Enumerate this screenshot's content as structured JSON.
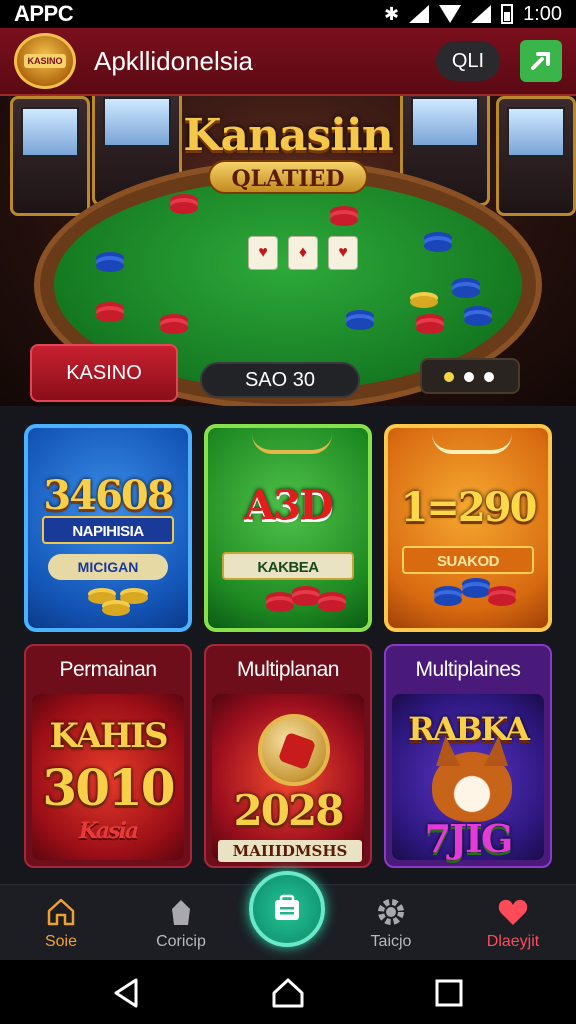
{
  "status_bar": {
    "left_text": "APPC",
    "time": "1:00"
  },
  "app_bar": {
    "logo_text": "KASINO",
    "title": "Apkllidonelsia",
    "pill_label": "QLI"
  },
  "hero": {
    "title": "Kanasiin",
    "subtitle": "QLATIED",
    "kasino_button": "KASINO",
    "pill_text": "SAO 30"
  },
  "grid": {
    "cards": [
      {
        "big": "34608",
        "ribbon": "NAPIHISIA",
        "mini": "MICIGAN"
      },
      {
        "big": "A3D",
        "ribbon": "KAKBEA"
      },
      {
        "big": "1=290",
        "ribbon": "SUAKOD"
      }
    ],
    "tiles": [
      {
        "title": "Permainan",
        "art_top": "KAHIS",
        "art_big": "3010",
        "art_script": "Kasia"
      },
      {
        "title": "Multiplanan",
        "art_big": "2028",
        "art_ribbon": "MAIIIDMSHS"
      },
      {
        "title": "Multiplaines",
        "art_top": "RABKA",
        "art_big": "7JIG"
      }
    ]
  },
  "bottom_nav": {
    "items": [
      {
        "label": "Soie",
        "icon": "home-icon",
        "color": "#f0a030"
      },
      {
        "label": "Coricip",
        "icon": "category-icon",
        "color": "#b8b8bc"
      },
      {
        "label": "Taicjo",
        "icon": "gear-icon",
        "color": "#b8b8bc"
      },
      {
        "label": "Dlaeyjit",
        "icon": "heart-icon",
        "color": "#ff4a5a"
      }
    ],
    "center_icon": "wallet-icon"
  },
  "colors": {
    "header_bg": "#6b0c18",
    "accent_gold": "#f5c84a",
    "fab_green": "#1fb48a"
  }
}
